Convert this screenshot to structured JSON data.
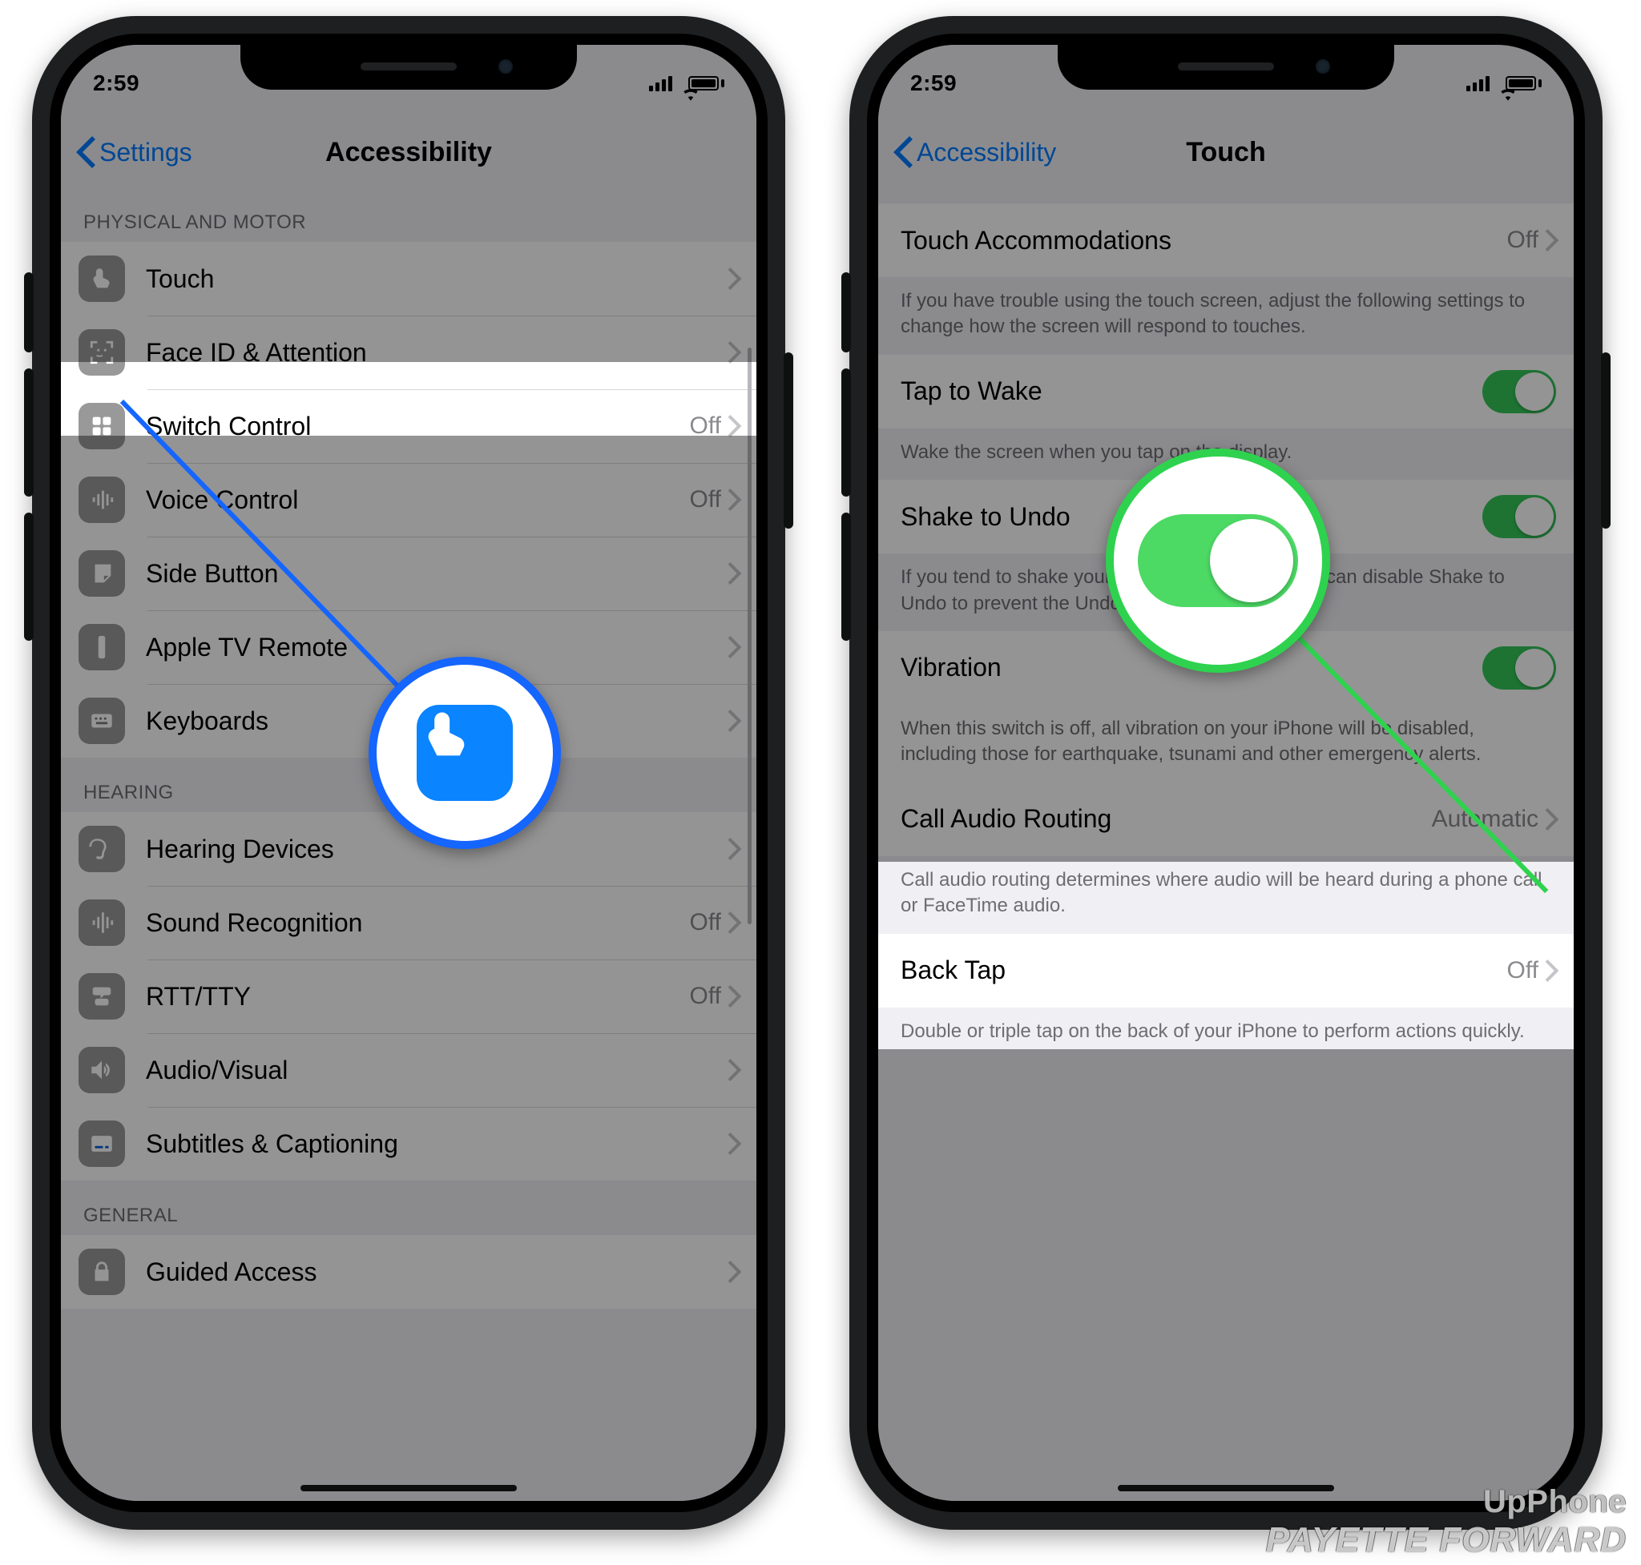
{
  "status": {
    "time": "2:59"
  },
  "left": {
    "nav": {
      "back": "Settings",
      "title": "Accessibility"
    },
    "sections": {
      "physical_header": "PHYSICAL AND MOTOR",
      "hearing_header": "HEARING",
      "general_header": "GENERAL"
    },
    "rows": {
      "touch": "Touch",
      "face_id": "Face ID & Attention",
      "switch_control": {
        "label": "Switch Control",
        "value": "Off"
      },
      "voice_control": {
        "label": "Voice Control",
        "value": "Off"
      },
      "side_button": "Side Button",
      "apple_tv": "Apple TV Remote",
      "keyboards": "Keyboards",
      "hearing_devices": "Hearing Devices",
      "sound_recognition": {
        "label": "Sound Recognition",
        "value": "Off"
      },
      "rtt_tty": {
        "label": "RTT/TTY",
        "value": "Off"
      },
      "audio_visual": "Audio/Visual",
      "subtitles": "Subtitles & Captioning",
      "guided_access": "Guided Access"
    }
  },
  "right": {
    "nav": {
      "back": "Accessibility",
      "title": "Touch"
    },
    "rows": {
      "touch_accommodations": {
        "label": "Touch Accommodations",
        "value": "Off"
      },
      "ta_note": "If you have trouble using the touch screen, adjust the following settings to change how the screen will respond to touches.",
      "tap_to_wake": "Tap to Wake",
      "ttw_note": "Wake the screen when you tap on the display.",
      "shake_to_undo": "Shake to Undo",
      "stu_note": "If you tend to shake your iPhone by accident, you can disable Shake to Undo to prevent the Undo alert from appearing.",
      "vibration": "Vibration",
      "vibration_note": "When this switch is off, all vibration on your iPhone will be disabled, including those for earthquake, tsunami and other emergency alerts.",
      "call_audio": {
        "label": "Call Audio Routing",
        "value": "Automatic"
      },
      "car_note": "Call audio routing determines where audio will be heard during a phone call or FaceTime audio.",
      "back_tap": {
        "label": "Back Tap",
        "value": "Off"
      },
      "bt_note": "Double or triple tap on the back of your iPhone to perform actions quickly."
    }
  },
  "watermarks": {
    "upphone": "UpPhone",
    "payette": "PAYETTE FORWARD"
  }
}
